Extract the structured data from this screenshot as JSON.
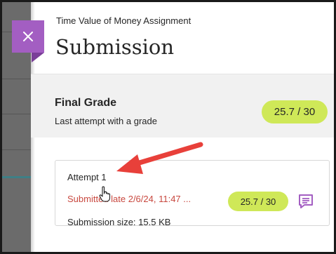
{
  "header": {
    "subtitle": "Time Value of Money Assignment",
    "title": "Submission"
  },
  "final_grade": {
    "heading": "Final Grade",
    "subtext": "Last attempt with a grade",
    "score": "25.7 / 30"
  },
  "attempt": {
    "title": "Attempt 1",
    "status": "Submitted late 2/6/24, 11:47 ...",
    "size": "Submission size: 15.5 KB",
    "score": "25.7 / 30"
  },
  "colors": {
    "accent_purple": "#a35ec2",
    "grade_pill": "#cfe858",
    "late_red": "#c8483f",
    "annotation_arrow": "#e8403a"
  },
  "icons": [
    "close-icon",
    "feedback-comment-icon",
    "pointer-hand-icon",
    "annotation-arrow"
  ]
}
